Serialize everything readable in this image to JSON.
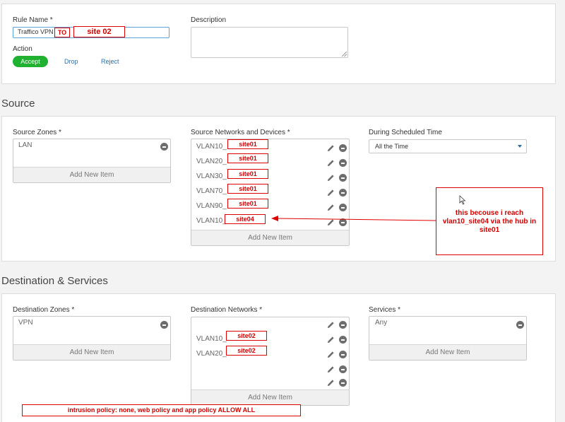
{
  "rule": {
    "name_label": "Rule Name *",
    "name_value": "Traffico VPN",
    "description_label": "Description",
    "action_label": "Action",
    "actions": [
      "Accept",
      "Drop",
      "Reject"
    ]
  },
  "source": {
    "title": "Source",
    "zones_label": "Source Zones *",
    "zones": [
      "LAN"
    ],
    "networks_label": "Source Networks and Devices *",
    "networks": [
      "VLAN10_",
      "VLAN20_",
      "VLAN30_",
      "VLAN70_",
      "VLAN90_",
      "VLAN10_"
    ],
    "schedule_label": "During Scheduled Time",
    "schedule_value": "All the Time",
    "add_new": "Add New Item"
  },
  "destination": {
    "title": "Destination & Services",
    "zones_label": "Destination Zones *",
    "zones": [
      "VPN"
    ],
    "networks_label": "Destination Networks *",
    "networks": [
      "VLAN10_",
      "VLAN20_",
      "",
      "",
      ""
    ],
    "services_label": "Services *",
    "services": [
      "Any"
    ],
    "add_new": "Add New Item"
  },
  "annotations": {
    "to": "TO",
    "site02_header": "site 02",
    "source_sites": [
      "site01",
      "site01",
      "site01",
      "site01",
      "site01",
      "site04"
    ],
    "dest_sites": [
      "site02",
      "site02"
    ],
    "note": "this becouse i reach vlan10_site04 via the hub in site01",
    "policy": "intrusion policy: none, web policy and app policy ALLOW ALL",
    "color": "#e00000"
  },
  "colors": {
    "accept": "#1fb12f",
    "link": "#2f6ea5",
    "focus_border": "#5ea3d8"
  }
}
